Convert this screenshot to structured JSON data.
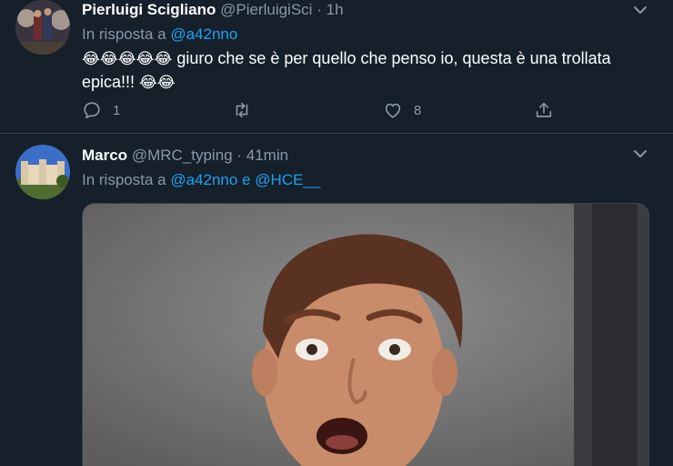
{
  "tweets": [
    {
      "author_name": "Pierluigi Scigliano",
      "handle": "@PierluigiSci",
      "separator": "·",
      "time": "1h",
      "reply_prefix": "In risposta a",
      "reply_to": "@a42nno",
      "reply_joiner": "",
      "reply_to_2": "",
      "emoji_lead": "😂😂😂😂😂",
      "text": " giuro che se è per quello che penso io, questa è una trollata epica!!! ",
      "emoji_tail": "😂😂",
      "reply_count": "1",
      "retweet_count": "",
      "like_count": "8"
    },
    {
      "author_name": "Marco",
      "handle": "@MRC_typing",
      "separator": "·",
      "time": "41min",
      "reply_prefix": "In risposta a",
      "reply_to": "@a42nno",
      "reply_joiner": "e",
      "reply_to_2": "@HCE__"
    }
  ],
  "icons": {
    "reply": "reply-icon",
    "retweet": "retweet-icon",
    "like": "heart-icon",
    "share": "share-icon",
    "menu": "chevron-down-icon"
  },
  "colors": {
    "background": "#15202b",
    "link": "#1da1f2",
    "muted": "#8899a6",
    "divider": "#38444d"
  }
}
